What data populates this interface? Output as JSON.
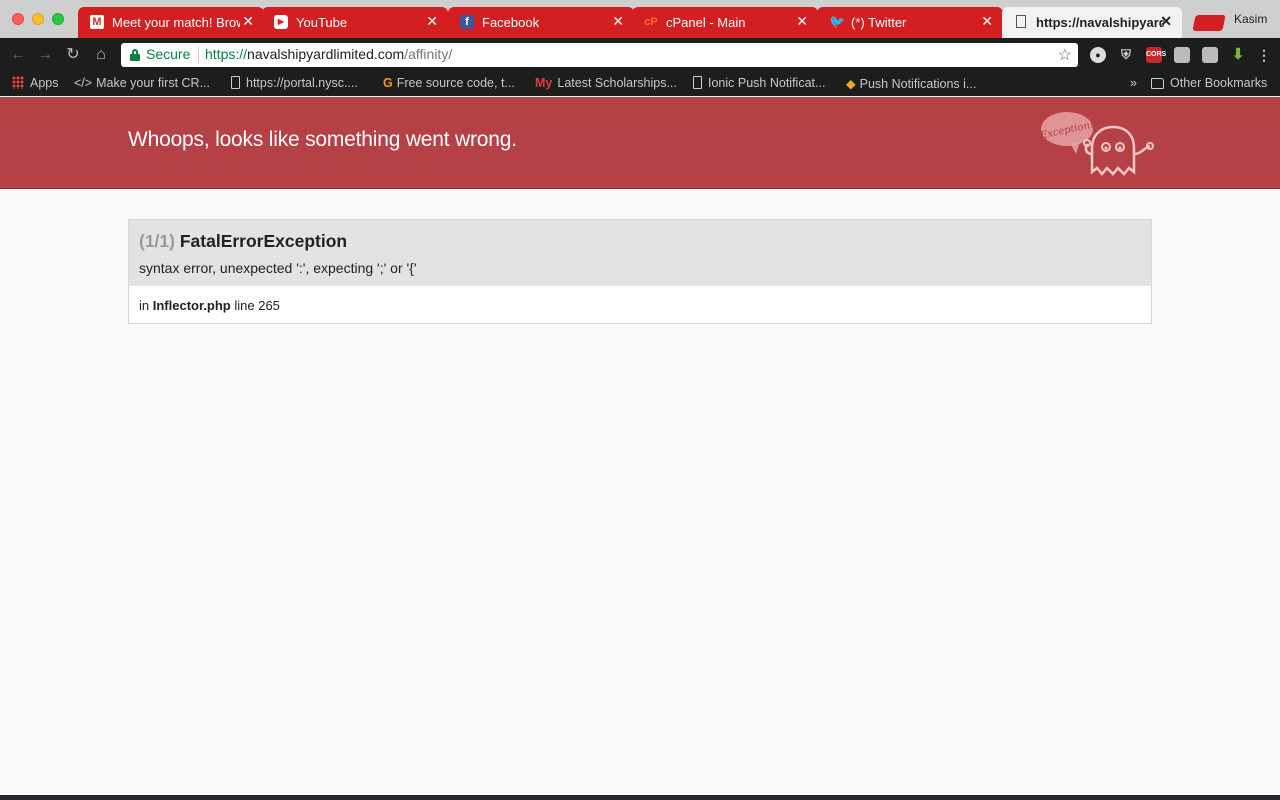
{
  "browser": {
    "tabs": [
      {
        "title": "Meet your match! Browse",
        "favicon": "gmail-icon",
        "active": false
      },
      {
        "title": "YouTube",
        "favicon": "youtube-icon",
        "active": false
      },
      {
        "title": "Facebook",
        "favicon": "facebook-icon",
        "active": false
      },
      {
        "title": "cPanel - Main",
        "favicon": "cpanel-icon",
        "active": false
      },
      {
        "title": "(*) Twitter",
        "favicon": "twitter-icon",
        "active": false
      },
      {
        "title": "https://navalshipyardlimited.com",
        "favicon": "document-icon",
        "active": true
      }
    ],
    "profile_name": "Kasim",
    "tab_color": "#d41f22"
  },
  "omnibox": {
    "security_label": "Secure",
    "url_scheme": "https://",
    "url_host": "navalshipyardlimited.com",
    "url_path": "/affinity/"
  },
  "bookmarks": {
    "items": [
      {
        "label": "Apps",
        "icon": "apps-grid-icon"
      },
      {
        "label": "Make your first CR...",
        "icon": "code-icon"
      },
      {
        "label": "https://portal.nysc....",
        "icon": "document-icon"
      },
      {
        "label": "Free source code, t...",
        "icon": "sourcecode-icon"
      },
      {
        "label": "Latest Scholarships...",
        "icon": "myschool-icon"
      },
      {
        "label": "Ionic Push Notificat...",
        "icon": "document-icon"
      },
      {
        "label": "Push Notifications i...",
        "icon": "tag-icon"
      }
    ],
    "overflow": "»",
    "other_bookmarks": "Other Bookmarks"
  },
  "page": {
    "banner_title": "Whoops, looks like something went wrong.",
    "ghost_label": "Exception!",
    "banner_color": "#b54045",
    "exception": {
      "count": "(1/1)",
      "type": "FatalErrorException",
      "message": "syntax error, unexpected ':', expecting ';' or '{'",
      "trace_prefix": "in",
      "file": "Inflector.php",
      "line_text": "line 265"
    }
  }
}
